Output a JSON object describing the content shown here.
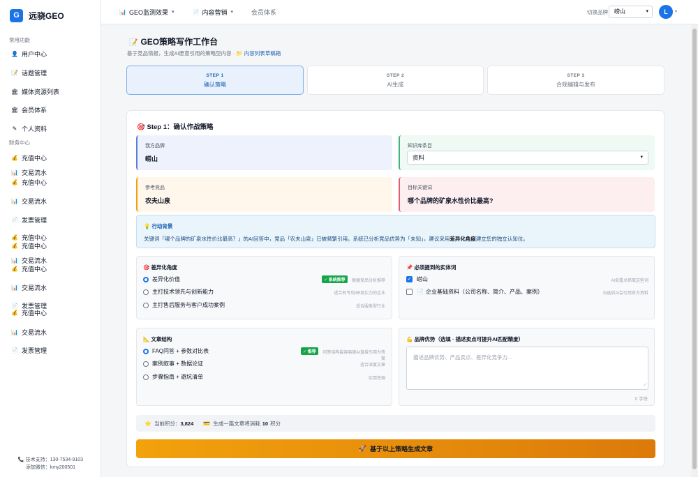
{
  "app": {
    "logo_letter": "G",
    "name": "远骁GEO"
  },
  "sidebar": {
    "section_common": "常用功能",
    "common_items": [
      {
        "icon": "user-icon",
        "label": "用户中心"
      },
      {
        "icon": "topic-icon",
        "label": "话题管理"
      },
      {
        "icon": "media-icon",
        "label": "媒体资源列表"
      },
      {
        "icon": "member-icon",
        "label": "会员体系"
      },
      {
        "icon": "profile-icon",
        "label": "个人资料"
      }
    ],
    "section_finance": "财务中心",
    "finance_items": [
      {
        "icon": "coin-icon",
        "label": "充值中心"
      },
      {
        "icon": "chart-icon",
        "label": "交易流水"
      },
      {
        "icon": "coin-icon",
        "label": "充值中心"
      },
      {
        "icon": "chart-icon",
        "label": "交易流水"
      },
      {
        "icon": "invoice-icon",
        "label": "发票管理"
      },
      {
        "icon": "coin-icon",
        "label": "充值中心"
      },
      {
        "icon": "coin-icon",
        "label": "充值中心"
      },
      {
        "icon": "chart-icon",
        "label": "交易流水"
      },
      {
        "icon": "coin-icon",
        "label": "充值中心"
      },
      {
        "icon": "chart-icon",
        "label": "交易流水"
      },
      {
        "icon": "invoice-icon",
        "label": "发票管理"
      },
      {
        "icon": "coin-icon",
        "label": "充值中心"
      },
      {
        "icon": "chart-icon",
        "label": "交易流水"
      },
      {
        "icon": "invoice-icon",
        "label": "发票管理"
      }
    ],
    "support_phone": "技术支持：130-7534-9103",
    "support_wechat": "添加微信：kmy200501"
  },
  "topbar": {
    "nav": [
      {
        "label": "GEO监测效果",
        "dropdown": true
      },
      {
        "label": "内容营销",
        "dropdown": true
      },
      {
        "label": "会员体系",
        "dropdown": false
      }
    ],
    "brand_label": "切换品牌",
    "brand_value": "崂山",
    "avatar_letter": "L"
  },
  "page": {
    "title": "GEO策略写作工作台",
    "subtitle": "基于竞品情报，生成AI愿意引用的策略型内容 · ",
    "subtitle_link": "内容列表草稿箱"
  },
  "steps": [
    {
      "num": "STEP 1",
      "label": "确认策略",
      "active": true
    },
    {
      "num": "STEP 2",
      "label": "AI生成",
      "active": false
    },
    {
      "num": "STEP 3",
      "label": "合规编辑与发布",
      "active": false
    }
  ],
  "step1": {
    "title": "Step 1：确认作战策略",
    "our_brand_label": "我方品牌",
    "our_brand": "崂山",
    "kb_label": "知识库条目",
    "kb_value": "资料",
    "competitor_label": "参考竞品",
    "competitor": "农夫山泉",
    "keyword_label": "目标关键词",
    "keyword": "哪个品牌的矿泉水性价比最高?"
  },
  "alert": {
    "title": "行动背景",
    "text_pre": "关键词「哪个品牌的矿泉水性价比最高？」的AI回答中，竞品「农夫山泉」已被频繁引用。系统已分析竞品优势为「未知」，建议采用",
    "text_strong": "差异化角度",
    "text_post": "建立您的独立认知位。"
  },
  "angle": {
    "title": "差异化角度",
    "options": [
      {
        "label": "差异化价值",
        "checked": true,
        "tag": "✓ 系统推荐",
        "hint": "根据竞品分析推荐"
      },
      {
        "label": "主打技术领先与创新能力",
        "checked": false,
        "hint": "适合有专利/研发实力的企业"
      },
      {
        "label": "主打售后服务与客户成功案例",
        "checked": false,
        "hint": "适合服务型行业"
      }
    ]
  },
  "entities": {
    "title": "必须提到的实体词",
    "options": [
      {
        "label": "崂山",
        "checked": true,
        "hint": "AI会重点抓取这些词"
      },
      {
        "label": "企业基础资料（公司名称、简介、产品、案例）",
        "checked": false,
        "hint": "与选后AI会引用官方资料"
      }
    ]
  },
  "structure": {
    "title": "文章结构",
    "options": [
      {
        "label": "FAQ问答 + 参数对比表",
        "checked": true,
        "tag": "✓ 推荐",
        "hint": "问答结构最容易被AI直接引用为答案"
      },
      {
        "label": "案例叙事 + 数据论证",
        "checked": false,
        "hint": "适合深度文章"
      },
      {
        "label": "步骤指南 + 避坑清单",
        "checked": false,
        "hint": "实用性强"
      }
    ]
  },
  "advantage": {
    "title": "品牌优势（选填 · 描述卖点可提升AI匹配精度）",
    "placeholder": "描述品牌优势、产品卖点、差异化竞争力...",
    "char_count": "0 字符"
  },
  "points": {
    "current_label": "当前积分：",
    "current_value": "3,824",
    "cost_pre": "生成一篇文章将消耗 ",
    "cost_value": "10",
    "cost_post": " 积分"
  },
  "generate_button": "基于以上策略生成文章",
  "colors": {
    "primary": "#1a73e8",
    "accent_orange": "#f2a20c",
    "success": "#16a34a"
  }
}
